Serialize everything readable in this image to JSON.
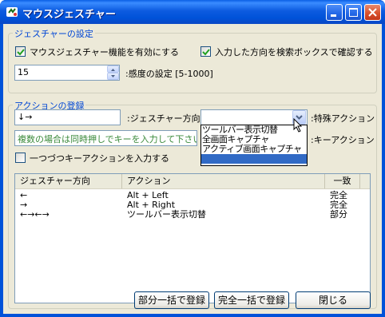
{
  "window": {
    "title": "マウスジェスチャー"
  },
  "settings_group": {
    "title": "ジェスチャーの設定",
    "enable_label": "マウスジェスチャー機能を有効にする",
    "enable_checked": true,
    "confirm_label": "入力した方向を検索ボックスで確認する",
    "confirm_checked": true,
    "sensitivity_value": "15",
    "sensitivity_label": ":感度の設定 [5-1000]"
  },
  "action_group": {
    "title": "アクションの登録",
    "direction_value": "↓→",
    "direction_label": ":ジェスチャー方向",
    "special_action_label": ":特殊アクション",
    "key_input_placeholder": "複数の場合は同時押しでキーを入力して下さい",
    "key_action_label": ":キーアクション",
    "one_by_one_label": "一つづつキーアクションを入力する",
    "one_by_one_checked": false,
    "special_action_options": [
      "ツールバー表示切替",
      "全画面キャプチャ",
      "アクティブ画面キャプチャ",
      ""
    ],
    "special_action_selected": ""
  },
  "table": {
    "columns": [
      "ジェスチャー方向",
      "アクション",
      "一致"
    ],
    "rows": [
      {
        "direction": "←",
        "action": "Alt + Left",
        "match": "完全"
      },
      {
        "direction": "→",
        "action": "Alt + Right",
        "match": "完全"
      },
      {
        "direction": "←→←→",
        "action": "ツールバー表示切替",
        "match": "部分"
      }
    ]
  },
  "buttons": {
    "register_partial": "部分一括で登録",
    "register_full": "完全一括で登録",
    "close": "閉じる"
  }
}
